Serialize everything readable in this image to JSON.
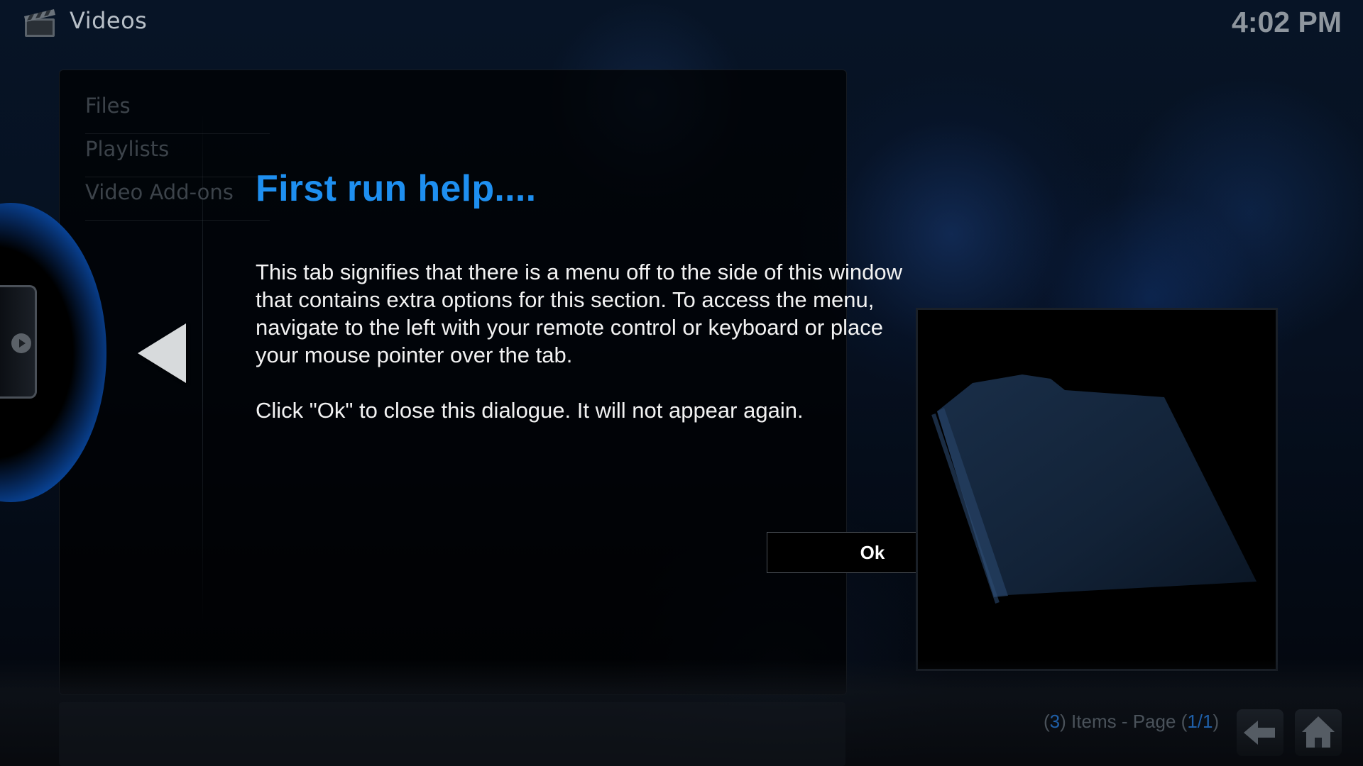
{
  "header": {
    "icon": "clapperboard-icon",
    "title": "Videos",
    "clock": "4:02 PM"
  },
  "menu": {
    "items": [
      {
        "label": "Files"
      },
      {
        "label": "Playlists"
      },
      {
        "label": "Video Add-ons"
      }
    ]
  },
  "dialog": {
    "title": "First run help....",
    "body": "This tab signifies that there is a menu off to the side of this window\nthat contains extra options for this section.  To access the menu,\nnavigate to the left with your remote control or keyboard or place\nyour mouse pointer over the tab.\n\nClick \"Ok\" to close this dialogue. It will not appear again.",
    "ok_label": "Ok",
    "title_color": "#1e8ff0"
  },
  "footer": {
    "item_count": "3",
    "items_label": " Items - Page ",
    "page": "1/1",
    "back_icon": "back-arrow-icon",
    "home_icon": "home-icon"
  },
  "colors": {
    "accent": "#1e8ff0",
    "tab_blue": "#1b79e6"
  }
}
